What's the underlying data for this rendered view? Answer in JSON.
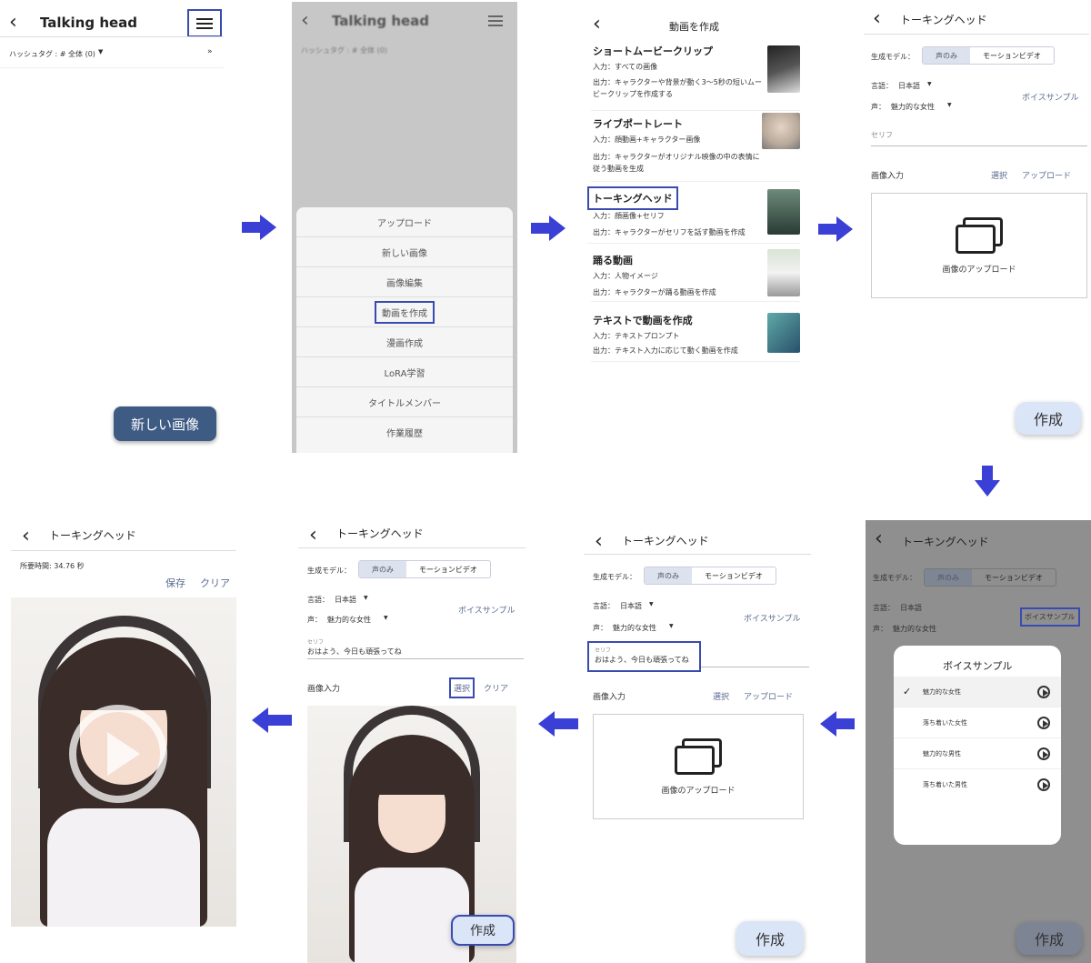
{
  "s1": {
    "title": "Talking head",
    "hashtag": "ハッシュタグ : # 全体 (0)",
    "new_image": "新しい画像"
  },
  "s2": {
    "title": "Talking head",
    "hashtag": "ハッシュタグ : # 全体 (0)",
    "menu": [
      "アップロード",
      "新しい画像",
      "画像編集",
      "動画を作成",
      "漫画作成",
      "LoRA学習",
      "タイトルメンバー",
      "作業履歴"
    ]
  },
  "s3": {
    "title": "動画を作成",
    "items": [
      {
        "title": "ショートムービークリップ",
        "l1": "入力：すべての画像",
        "l2": "出力：キャラクターや背景が動く3〜5秒の短いムービークリップを作成する"
      },
      {
        "title": "ライブポートレート",
        "l1": "入力：顔動画+キャラクター画像",
        "l2": "出力：キャラクターがオリジナル映像の中の表情に従う動画を生成"
      },
      {
        "title": "トーキングヘッド",
        "l1": "入力：顔画像+セリフ",
        "l2": "出力：キャラクターがセリフを話す動画を作成"
      },
      {
        "title": "踊る動画",
        "l1": "入力：人物イメージ",
        "l2": "出力：キャラクターが踊る動画を作成"
      },
      {
        "title": "テキストで動画を作成",
        "l1": "入力：テキストプロンプト",
        "l2": "出力：テキスト入力に応じて動く動画を作成"
      }
    ]
  },
  "form": {
    "title": "トーキングヘッド",
    "model_label": "生成モデル：",
    "model_a": "声のみ",
    "model_b": "モーションビデオ",
    "lang_label": "言語：",
    "lang": "日本語",
    "voice_label": "声：",
    "voice": "魅力的な女性",
    "voice_sample": "ボイスサンプル",
    "serif": "セリフ",
    "serif_value": "おはよう、今日も頑張ってね",
    "image_input": "画像入力",
    "select": "選択",
    "upload": "アップロード",
    "clear": "クリア",
    "upload_image": "画像のアップロード",
    "create": "作成"
  },
  "popup": {
    "title": "ボイスサンプル",
    "items": [
      "魅力的な女性",
      "落ち着いた女性",
      "魅力的な男性",
      "落ち着いた男性"
    ]
  },
  "result": {
    "title": "トーキングヘッド",
    "time": "所要時間: 34.76 秒",
    "save": "保存",
    "clear": "クリア"
  }
}
